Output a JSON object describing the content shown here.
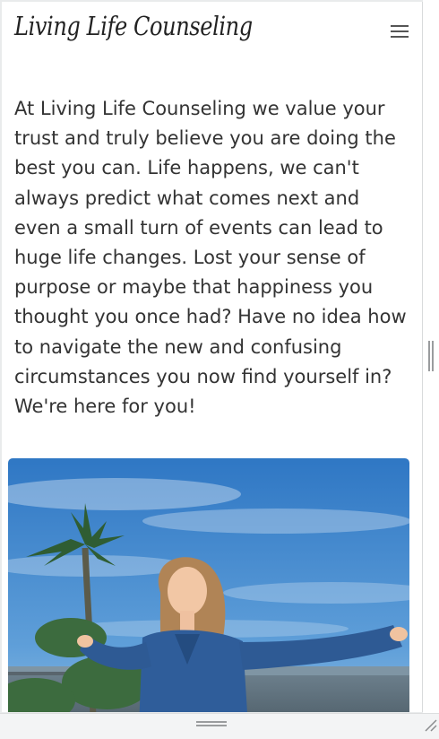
{
  "header": {
    "brand": "Living Life Counseling",
    "menu_icon": "hamburger-icon"
  },
  "main": {
    "intro": "At Living Life Counseling we value your trust and truly believe you are doing the best you can. Life happens, we can't always predict what comes next and even a small turn of events can lead to huge life changes. Lost your sense of purpose or maybe that happiness you thought you once had? Have no idea how to navigate the new and confusing circumstances you now find yourself in? We're here for you!"
  },
  "colors": {
    "text": "#333333",
    "sky": "#3f86cf",
    "denim": "#2f5d9a"
  }
}
